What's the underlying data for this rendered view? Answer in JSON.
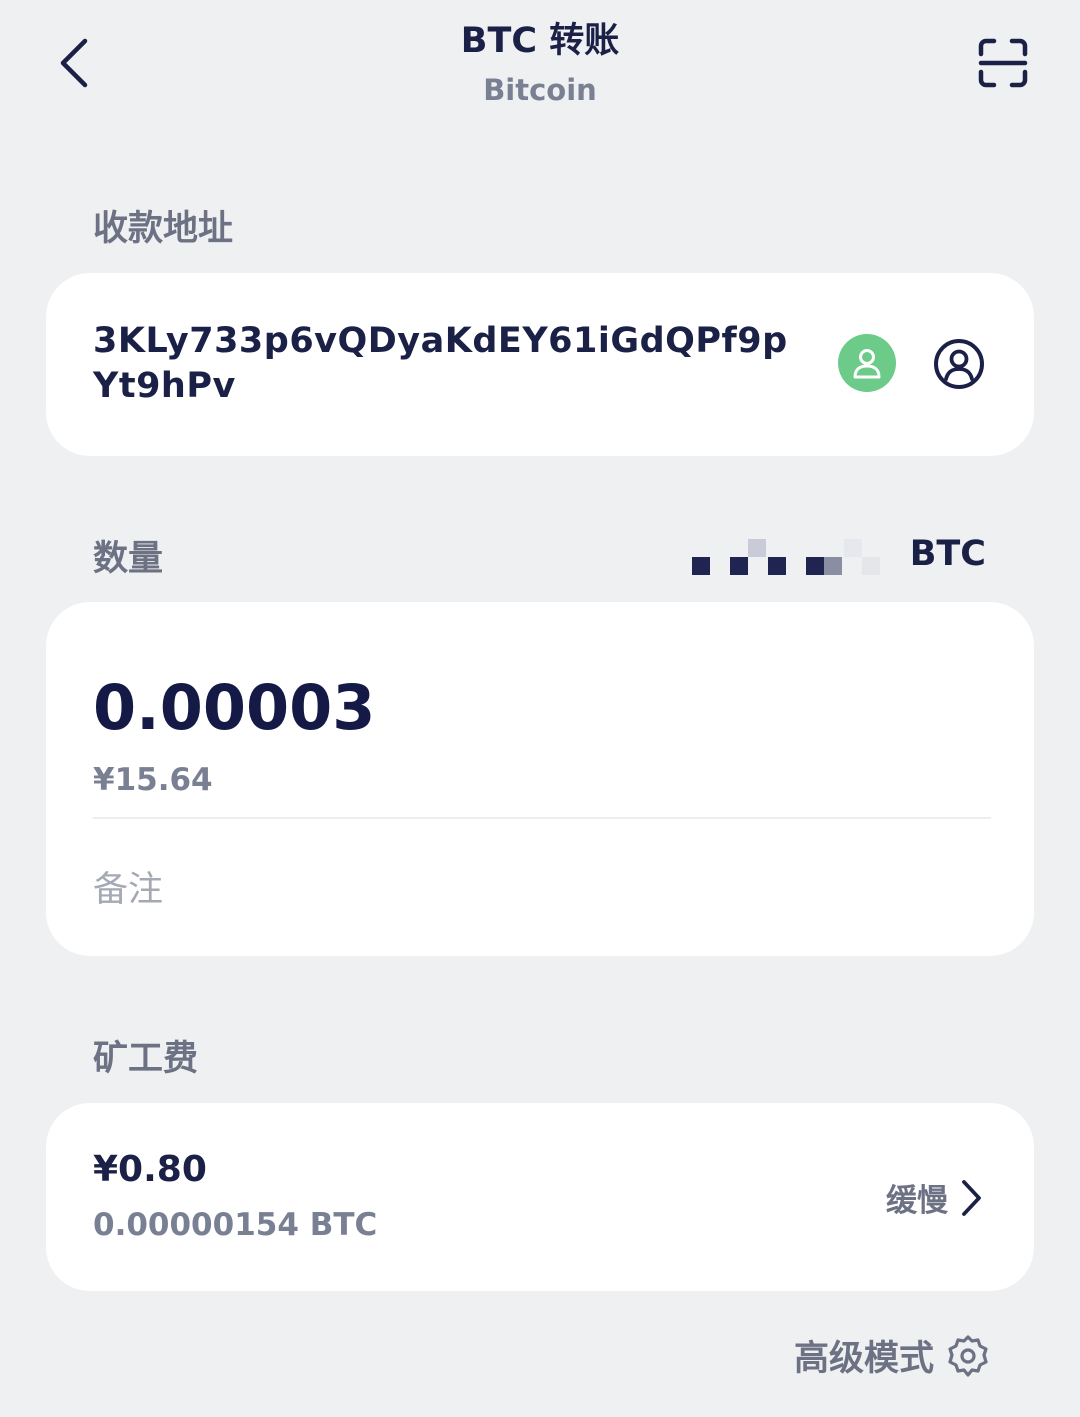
{
  "header": {
    "title": "BTC 转账",
    "subtitle": "Bitcoin"
  },
  "recipient": {
    "label": "收款地址",
    "address": "3KLy733p6vQDyaKdEY61iGdQPf9pYt9hPv"
  },
  "amount": {
    "label": "数量",
    "balance_unit": "BTC",
    "value": "0.00003",
    "fiat": "¥15.64",
    "memo_placeholder": "备注"
  },
  "fee": {
    "label": "矿工费",
    "fiat": "¥0.80",
    "crypto": "0.00000154 BTC",
    "speed": "缓慢"
  },
  "advanced": {
    "label": "高级模式"
  },
  "colors": {
    "background": "#eff0f2",
    "card": "#ffffff",
    "primary_text": "#1b2047",
    "secondary_text": "#7a8093",
    "contact_green": "#6ccb88"
  },
  "icons": {
    "back": "chevron-left-icon",
    "scan": "scan-icon",
    "contact_book": "user-icon",
    "my_account": "user-circle-icon",
    "fee_speed": "chevron-right-icon",
    "advanced": "gear-icon"
  }
}
